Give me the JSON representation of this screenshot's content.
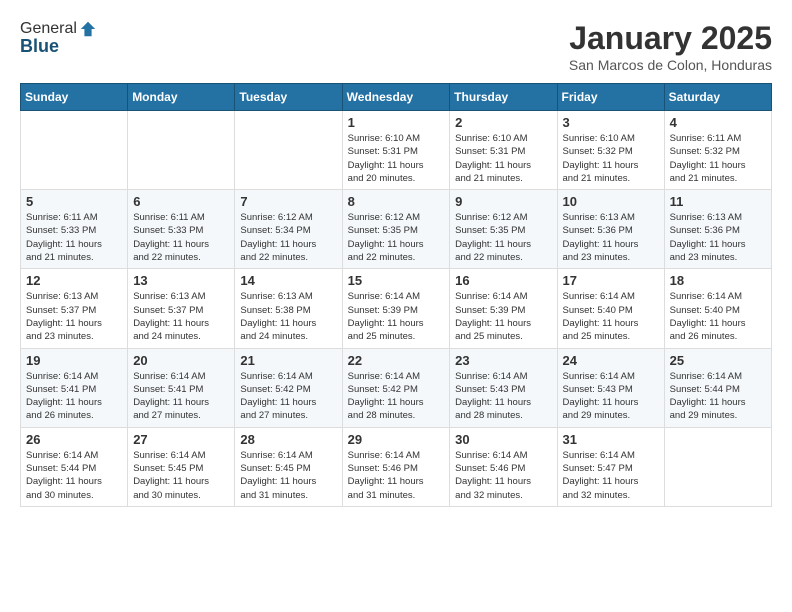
{
  "logo": {
    "line1": "General",
    "line2": "Blue"
  },
  "header": {
    "title": "January 2025",
    "subtitle": "San Marcos de Colon, Honduras"
  },
  "weekdays": [
    "Sunday",
    "Monday",
    "Tuesday",
    "Wednesday",
    "Thursday",
    "Friday",
    "Saturday"
  ],
  "weeks": [
    [
      {
        "day": "",
        "info": ""
      },
      {
        "day": "",
        "info": ""
      },
      {
        "day": "",
        "info": ""
      },
      {
        "day": "1",
        "info": "Sunrise: 6:10 AM\nSunset: 5:31 PM\nDaylight: 11 hours\nand 20 minutes."
      },
      {
        "day": "2",
        "info": "Sunrise: 6:10 AM\nSunset: 5:31 PM\nDaylight: 11 hours\nand 21 minutes."
      },
      {
        "day": "3",
        "info": "Sunrise: 6:10 AM\nSunset: 5:32 PM\nDaylight: 11 hours\nand 21 minutes."
      },
      {
        "day": "4",
        "info": "Sunrise: 6:11 AM\nSunset: 5:32 PM\nDaylight: 11 hours\nand 21 minutes."
      }
    ],
    [
      {
        "day": "5",
        "info": "Sunrise: 6:11 AM\nSunset: 5:33 PM\nDaylight: 11 hours\nand 21 minutes."
      },
      {
        "day": "6",
        "info": "Sunrise: 6:11 AM\nSunset: 5:33 PM\nDaylight: 11 hours\nand 22 minutes."
      },
      {
        "day": "7",
        "info": "Sunrise: 6:12 AM\nSunset: 5:34 PM\nDaylight: 11 hours\nand 22 minutes."
      },
      {
        "day": "8",
        "info": "Sunrise: 6:12 AM\nSunset: 5:35 PM\nDaylight: 11 hours\nand 22 minutes."
      },
      {
        "day": "9",
        "info": "Sunrise: 6:12 AM\nSunset: 5:35 PM\nDaylight: 11 hours\nand 22 minutes."
      },
      {
        "day": "10",
        "info": "Sunrise: 6:13 AM\nSunset: 5:36 PM\nDaylight: 11 hours\nand 23 minutes."
      },
      {
        "day": "11",
        "info": "Sunrise: 6:13 AM\nSunset: 5:36 PM\nDaylight: 11 hours\nand 23 minutes."
      }
    ],
    [
      {
        "day": "12",
        "info": "Sunrise: 6:13 AM\nSunset: 5:37 PM\nDaylight: 11 hours\nand 23 minutes."
      },
      {
        "day": "13",
        "info": "Sunrise: 6:13 AM\nSunset: 5:37 PM\nDaylight: 11 hours\nand 24 minutes."
      },
      {
        "day": "14",
        "info": "Sunrise: 6:13 AM\nSunset: 5:38 PM\nDaylight: 11 hours\nand 24 minutes."
      },
      {
        "day": "15",
        "info": "Sunrise: 6:14 AM\nSunset: 5:39 PM\nDaylight: 11 hours\nand 25 minutes."
      },
      {
        "day": "16",
        "info": "Sunrise: 6:14 AM\nSunset: 5:39 PM\nDaylight: 11 hours\nand 25 minutes."
      },
      {
        "day": "17",
        "info": "Sunrise: 6:14 AM\nSunset: 5:40 PM\nDaylight: 11 hours\nand 25 minutes."
      },
      {
        "day": "18",
        "info": "Sunrise: 6:14 AM\nSunset: 5:40 PM\nDaylight: 11 hours\nand 26 minutes."
      }
    ],
    [
      {
        "day": "19",
        "info": "Sunrise: 6:14 AM\nSunset: 5:41 PM\nDaylight: 11 hours\nand 26 minutes."
      },
      {
        "day": "20",
        "info": "Sunrise: 6:14 AM\nSunset: 5:41 PM\nDaylight: 11 hours\nand 27 minutes."
      },
      {
        "day": "21",
        "info": "Sunrise: 6:14 AM\nSunset: 5:42 PM\nDaylight: 11 hours\nand 27 minutes."
      },
      {
        "day": "22",
        "info": "Sunrise: 6:14 AM\nSunset: 5:42 PM\nDaylight: 11 hours\nand 28 minutes."
      },
      {
        "day": "23",
        "info": "Sunrise: 6:14 AM\nSunset: 5:43 PM\nDaylight: 11 hours\nand 28 minutes."
      },
      {
        "day": "24",
        "info": "Sunrise: 6:14 AM\nSunset: 5:43 PM\nDaylight: 11 hours\nand 29 minutes."
      },
      {
        "day": "25",
        "info": "Sunrise: 6:14 AM\nSunset: 5:44 PM\nDaylight: 11 hours\nand 29 minutes."
      }
    ],
    [
      {
        "day": "26",
        "info": "Sunrise: 6:14 AM\nSunset: 5:44 PM\nDaylight: 11 hours\nand 30 minutes."
      },
      {
        "day": "27",
        "info": "Sunrise: 6:14 AM\nSunset: 5:45 PM\nDaylight: 11 hours\nand 30 minutes."
      },
      {
        "day": "28",
        "info": "Sunrise: 6:14 AM\nSunset: 5:45 PM\nDaylight: 11 hours\nand 31 minutes."
      },
      {
        "day": "29",
        "info": "Sunrise: 6:14 AM\nSunset: 5:46 PM\nDaylight: 11 hours\nand 31 minutes."
      },
      {
        "day": "30",
        "info": "Sunrise: 6:14 AM\nSunset: 5:46 PM\nDaylight: 11 hours\nand 32 minutes."
      },
      {
        "day": "31",
        "info": "Sunrise: 6:14 AM\nSunset: 5:47 PM\nDaylight: 11 hours\nand 32 minutes."
      },
      {
        "day": "",
        "info": ""
      }
    ]
  ]
}
